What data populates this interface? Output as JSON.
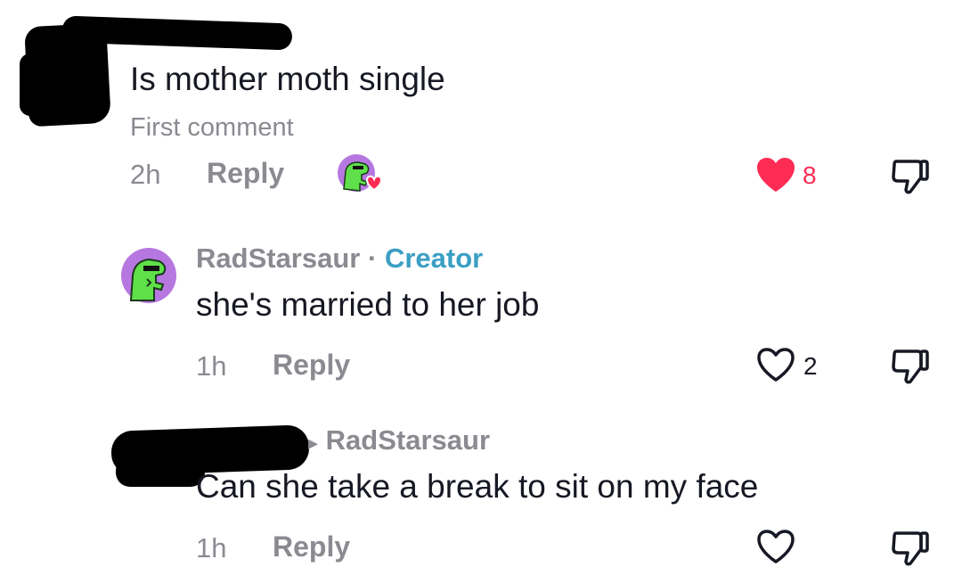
{
  "comments": [
    {
      "text": "Is mother moth single",
      "badge": "First comment",
      "time": "2h",
      "reply_label": "Reply",
      "like_count": "8",
      "liked": true,
      "creator_liked": true
    },
    {
      "username": "RadStarsaur",
      "separator": "·",
      "role": "Creator",
      "text": "she's married to her job",
      "time": "1h",
      "reply_label": "Reply",
      "like_count": "2",
      "liked": false
    },
    {
      "reply_to_arrow": "▸",
      "reply_to": "RadStarsaur",
      "text": "Can she take a break to sit on my face",
      "time": "1h",
      "reply_label": "Reply",
      "like_count": "",
      "liked": false
    }
  ],
  "colors": {
    "like_active": "#fe2c55",
    "creator_accent": "#3b9fc4",
    "muted_text": "#8a8b91",
    "avatar_bg": "#b678e0",
    "dino_green": "#5fe04a"
  },
  "icons": [
    "heart-icon",
    "dislike-icon",
    "creator-like-avatar-icon",
    "redaction-marker"
  ]
}
